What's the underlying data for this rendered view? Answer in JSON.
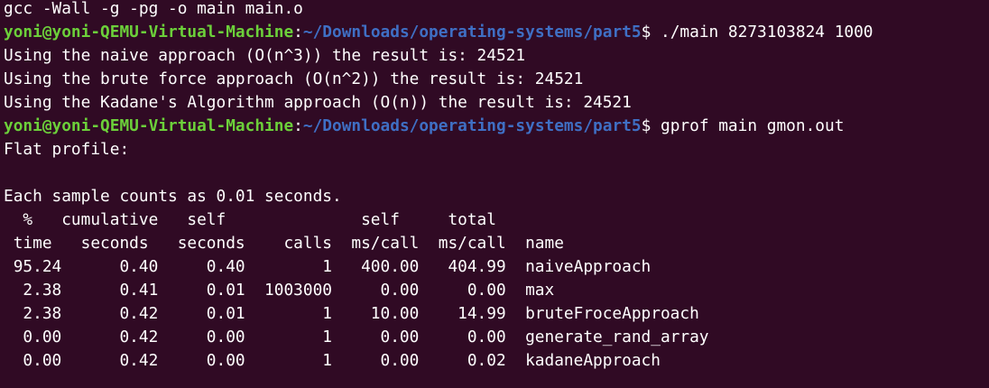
{
  "terminal": {
    "lines": [
      {
        "type": "output",
        "text": "gcc -Wall -g -pg -o main main.o"
      },
      {
        "type": "prompt",
        "user": "yoni@yoni-QEMU-Virtual-Machine",
        "sep": ":",
        "path": "~/Downloads/operating-systems/part5",
        "symbol": "$ ",
        "command": "./main 8273103824 1000"
      },
      {
        "type": "output",
        "text": "Using the naive approach (O(n^3)) the result is: 24521"
      },
      {
        "type": "output",
        "text": "Using the brute force approach (O(n^2)) the result is: 24521"
      },
      {
        "type": "output",
        "text": "Using the Kadane's Algorithm approach (O(n)) the result is: 24521"
      },
      {
        "type": "prompt",
        "user": "yoni@yoni-QEMU-Virtual-Machine",
        "sep": ":",
        "path": "~/Downloads/operating-systems/part5",
        "symbol": "$ ",
        "command": "gprof main gmon.out"
      },
      {
        "type": "output",
        "text": "Flat profile:"
      },
      {
        "type": "output",
        "text": ""
      },
      {
        "type": "output",
        "text": "Each sample counts as 0.01 seconds."
      },
      {
        "type": "output",
        "text": "  %   cumulative   self              self     total           "
      },
      {
        "type": "output",
        "text": " time   seconds   seconds    calls  ms/call  ms/call  name    "
      },
      {
        "type": "output",
        "text": " 95.24      0.40     0.40        1   400.00   404.99  naiveApproach"
      },
      {
        "type": "output",
        "text": "  2.38      0.41     0.01  1003000     0.00     0.00  max"
      },
      {
        "type": "output",
        "text": "  2.38      0.42     0.01        1    10.00    14.99  bruteFroceApproach"
      },
      {
        "type": "output",
        "text": "  0.00      0.42     0.00        1     0.00     0.00  generate_rand_array"
      },
      {
        "type": "output",
        "text": "  0.00      0.42     0.00        1     0.00     0.02  kadaneApproach"
      }
    ]
  },
  "colors": {
    "background": "#300a24",
    "prompt_user": "#6cd03a",
    "prompt_path": "#3f6fc4",
    "text": "#ffffff"
  }
}
